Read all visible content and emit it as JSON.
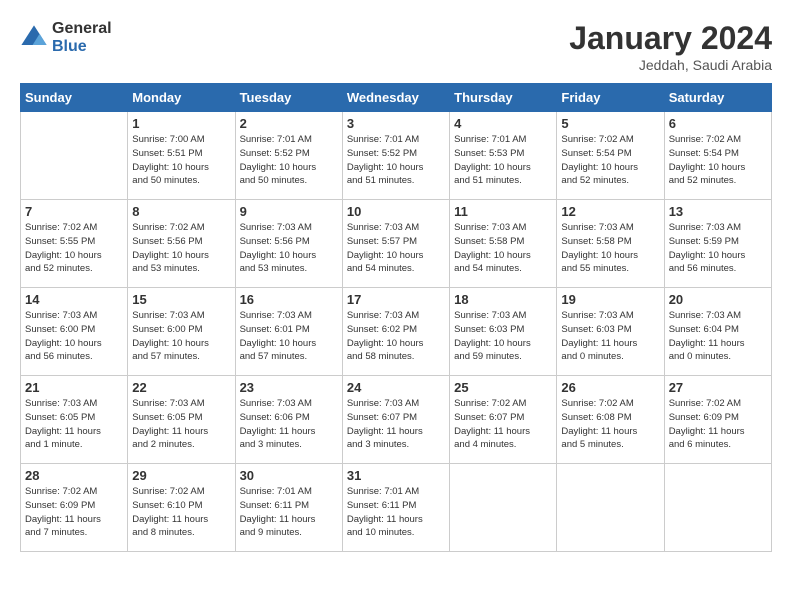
{
  "logo": {
    "general": "General",
    "blue": "Blue"
  },
  "title": "January 2024",
  "location": "Jeddah, Saudi Arabia",
  "days_header": [
    "Sunday",
    "Monday",
    "Tuesday",
    "Wednesday",
    "Thursday",
    "Friday",
    "Saturday"
  ],
  "weeks": [
    [
      {
        "num": "",
        "info": ""
      },
      {
        "num": "1",
        "info": "Sunrise: 7:00 AM\nSunset: 5:51 PM\nDaylight: 10 hours\nand 50 minutes."
      },
      {
        "num": "2",
        "info": "Sunrise: 7:01 AM\nSunset: 5:52 PM\nDaylight: 10 hours\nand 50 minutes."
      },
      {
        "num": "3",
        "info": "Sunrise: 7:01 AM\nSunset: 5:52 PM\nDaylight: 10 hours\nand 51 minutes."
      },
      {
        "num": "4",
        "info": "Sunrise: 7:01 AM\nSunset: 5:53 PM\nDaylight: 10 hours\nand 51 minutes."
      },
      {
        "num": "5",
        "info": "Sunrise: 7:02 AM\nSunset: 5:54 PM\nDaylight: 10 hours\nand 52 minutes."
      },
      {
        "num": "6",
        "info": "Sunrise: 7:02 AM\nSunset: 5:54 PM\nDaylight: 10 hours\nand 52 minutes."
      }
    ],
    [
      {
        "num": "7",
        "info": "Sunrise: 7:02 AM\nSunset: 5:55 PM\nDaylight: 10 hours\nand 52 minutes."
      },
      {
        "num": "8",
        "info": "Sunrise: 7:02 AM\nSunset: 5:56 PM\nDaylight: 10 hours\nand 53 minutes."
      },
      {
        "num": "9",
        "info": "Sunrise: 7:03 AM\nSunset: 5:56 PM\nDaylight: 10 hours\nand 53 minutes."
      },
      {
        "num": "10",
        "info": "Sunrise: 7:03 AM\nSunset: 5:57 PM\nDaylight: 10 hours\nand 54 minutes."
      },
      {
        "num": "11",
        "info": "Sunrise: 7:03 AM\nSunset: 5:58 PM\nDaylight: 10 hours\nand 54 minutes."
      },
      {
        "num": "12",
        "info": "Sunrise: 7:03 AM\nSunset: 5:58 PM\nDaylight: 10 hours\nand 55 minutes."
      },
      {
        "num": "13",
        "info": "Sunrise: 7:03 AM\nSunset: 5:59 PM\nDaylight: 10 hours\nand 56 minutes."
      }
    ],
    [
      {
        "num": "14",
        "info": "Sunrise: 7:03 AM\nSunset: 6:00 PM\nDaylight: 10 hours\nand 56 minutes."
      },
      {
        "num": "15",
        "info": "Sunrise: 7:03 AM\nSunset: 6:00 PM\nDaylight: 10 hours\nand 57 minutes."
      },
      {
        "num": "16",
        "info": "Sunrise: 7:03 AM\nSunset: 6:01 PM\nDaylight: 10 hours\nand 57 minutes."
      },
      {
        "num": "17",
        "info": "Sunrise: 7:03 AM\nSunset: 6:02 PM\nDaylight: 10 hours\nand 58 minutes."
      },
      {
        "num": "18",
        "info": "Sunrise: 7:03 AM\nSunset: 6:03 PM\nDaylight: 10 hours\nand 59 minutes."
      },
      {
        "num": "19",
        "info": "Sunrise: 7:03 AM\nSunset: 6:03 PM\nDaylight: 11 hours\nand 0 minutes."
      },
      {
        "num": "20",
        "info": "Sunrise: 7:03 AM\nSunset: 6:04 PM\nDaylight: 11 hours\nand 0 minutes."
      }
    ],
    [
      {
        "num": "21",
        "info": "Sunrise: 7:03 AM\nSunset: 6:05 PM\nDaylight: 11 hours\nand 1 minute."
      },
      {
        "num": "22",
        "info": "Sunrise: 7:03 AM\nSunset: 6:05 PM\nDaylight: 11 hours\nand 2 minutes."
      },
      {
        "num": "23",
        "info": "Sunrise: 7:03 AM\nSunset: 6:06 PM\nDaylight: 11 hours\nand 3 minutes."
      },
      {
        "num": "24",
        "info": "Sunrise: 7:03 AM\nSunset: 6:07 PM\nDaylight: 11 hours\nand 3 minutes."
      },
      {
        "num": "25",
        "info": "Sunrise: 7:02 AM\nSunset: 6:07 PM\nDaylight: 11 hours\nand 4 minutes."
      },
      {
        "num": "26",
        "info": "Sunrise: 7:02 AM\nSunset: 6:08 PM\nDaylight: 11 hours\nand 5 minutes."
      },
      {
        "num": "27",
        "info": "Sunrise: 7:02 AM\nSunset: 6:09 PM\nDaylight: 11 hours\nand 6 minutes."
      }
    ],
    [
      {
        "num": "28",
        "info": "Sunrise: 7:02 AM\nSunset: 6:09 PM\nDaylight: 11 hours\nand 7 minutes."
      },
      {
        "num": "29",
        "info": "Sunrise: 7:02 AM\nSunset: 6:10 PM\nDaylight: 11 hours\nand 8 minutes."
      },
      {
        "num": "30",
        "info": "Sunrise: 7:01 AM\nSunset: 6:11 PM\nDaylight: 11 hours\nand 9 minutes."
      },
      {
        "num": "31",
        "info": "Sunrise: 7:01 AM\nSunset: 6:11 PM\nDaylight: 11 hours\nand 10 minutes."
      },
      {
        "num": "",
        "info": ""
      },
      {
        "num": "",
        "info": ""
      },
      {
        "num": "",
        "info": ""
      }
    ]
  ]
}
